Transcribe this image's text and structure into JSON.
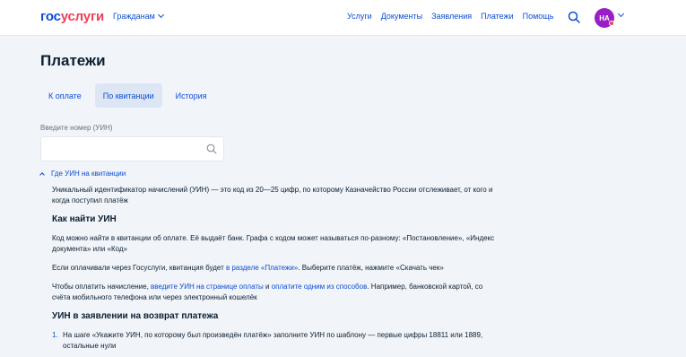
{
  "header": {
    "logo_part1": "гос",
    "logo_part2": "услуги",
    "citizen_label": "Гражданам",
    "nav": [
      "Услуги",
      "Документы",
      "Заявления",
      "Платежи",
      "Помощь"
    ],
    "avatar_initials": "НА",
    "accent_color": "#0d4cd3",
    "avatar_color": "#9a1ec8"
  },
  "page": {
    "title": "Платежи",
    "tabs": [
      {
        "label": "К оплате",
        "active": false
      },
      {
        "label": "По квитанции",
        "active": true
      },
      {
        "label": "История",
        "active": false
      }
    ]
  },
  "search": {
    "label": "Введите номер (УИН)",
    "value": "",
    "placeholder": ""
  },
  "faq": {
    "toggle_label": "Где УИН на квитанции",
    "intro": "Уникальный идентификатор начислений (УИН) — это код из 20—25 цифр, по которому Казначейство России отслеживает, от кого и когда поступил платёж",
    "how_title": "Как найти УИН",
    "how_text": "Код можно найти в квитанции об оплате. Её выдаёт банк. Графа с кодом может называться по-разному: «Постановление», «Индекс документа» или «Код»",
    "gosuslugi_pre": "Если оплачивали через Госуслуги, квитанция будет ",
    "gosuslugi_link": "в разделе «Платежи»",
    "gosuslugi_post": ". Выберите платёж, нажмите «Скачать чек»",
    "pay_pre": "Чтобы оплатить начисление, ",
    "pay_link1": "введите УИН на странице оплаты",
    "pay_mid": " и ",
    "pay_link2": "оплатите одним из способов",
    "pay_post": ". Например, банковской картой, со счёта мобильного телефона или через электронный кошелёк",
    "refund_title": "УИН в заявлении на возврат платежа",
    "steps": [
      {
        "num": "1.",
        "text": "На шаге «Укажите УИН, по которому был произведён платёж» заполните УИН по шаблону — первые цифры 18811 или 1889, остальные нули"
      }
    ]
  }
}
